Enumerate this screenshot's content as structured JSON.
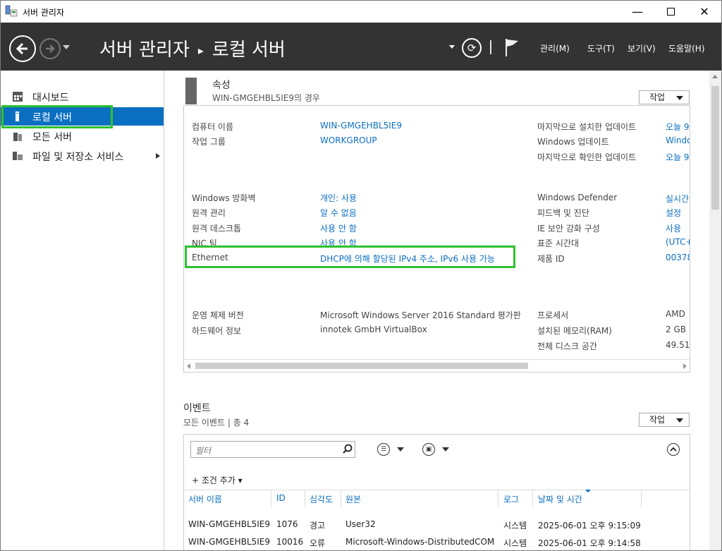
{
  "window": {
    "title": "서버 관리자"
  },
  "header": {
    "breadcrumb_root": "서버 관리자",
    "breadcrumb_sep": "▸",
    "breadcrumb_current": "로컬 서버",
    "menus": [
      "관리(M)",
      "도구(T)",
      "보기(V)",
      "도움말(H)"
    ]
  },
  "sidebar": {
    "items": [
      {
        "label": "대시보드",
        "icon": "dashboard-icon"
      },
      {
        "label": "로컬 서버",
        "icon": "server-icon",
        "selected": true
      },
      {
        "label": "모든 서버",
        "icon": "servers-icon"
      },
      {
        "label": "파일 및 저장소 서비스",
        "icon": "storage-icon",
        "has_children": true
      }
    ]
  },
  "properties": {
    "title": "속성",
    "subtitle": "WIN-GMGEHBL5IE9의 경우",
    "tasks_label": "작업",
    "left": [
      {
        "key": "컴퓨터 이름",
        "value": "WIN-GMGEHBL5IE9"
      },
      {
        "key": "작업 그룹",
        "value": "WORKGROUP"
      },
      {
        "key": "Windows 방화벽",
        "value": "개인: 사용"
      },
      {
        "key": "원격 관리",
        "value": "알 수 없음"
      },
      {
        "key": "원격 데스크톱",
        "value": "사용 안 함"
      },
      {
        "key": "NIC 팀",
        "value": "사용 안 함"
      },
      {
        "key": "Ethernet",
        "value": "DHCP에 의해 할당된 IPv4 주소, IPv6 사용 가능"
      },
      {
        "key": "운영 체제 버전",
        "value": "Microsoft Windows Server 2016 Standard 평가판"
      },
      {
        "key": "하드웨어 정보",
        "value": "innotek GmbH VirtualBox"
      }
    ],
    "right": [
      {
        "key": "마지막으로 설치한 업데이트",
        "value": "오늘 9"
      },
      {
        "key": "Windows 업데이트",
        "value": "Windo"
      },
      {
        "key": "마지막으로 확인한 업데이트",
        "value": "오늘 9"
      },
      {
        "key": "Windows Defender",
        "value": "실시간"
      },
      {
        "key": "피드백 및 진단",
        "value": "설정"
      },
      {
        "key": "IE 보안 강화 구성",
        "value": "사용"
      },
      {
        "key": "표준 시간대",
        "value": "(UTC+"
      },
      {
        "key": "제품 ID",
        "value": "00378"
      },
      {
        "key": "프로세서",
        "value": "AMD"
      },
      {
        "key": "설치된 메모리(RAM)",
        "value": "2 GB"
      },
      {
        "key": "전체 디스크 공간",
        "value": "49.51"
      }
    ]
  },
  "events": {
    "title": "이벤트",
    "subtitle": "모든 이벤트 | 총 4",
    "tasks_label": "작업",
    "filter_placeholder": "필터",
    "add_criteria": "+ 조건 추가 ▾",
    "columns": [
      "서버 이름",
      "ID",
      "심각도",
      "원본",
      "로그",
      "날짜 및 시간"
    ],
    "rows": [
      [
        "WIN-GMGEHBL5IE9",
        "1076",
        "경고",
        "User32",
        "시스템",
        "2025-06-01 오후 9:15:09"
      ],
      [
        "WIN-GMGEHBL5IE9",
        "10016",
        "오류",
        "Microsoft-Windows-DistributedCOM",
        "시스템",
        "2025-06-01 오후 9:14:58"
      ]
    ]
  },
  "colors": {
    "accent": "#0b6fc1",
    "header_bg": "#333333",
    "highlight": "#2fc12f"
  }
}
